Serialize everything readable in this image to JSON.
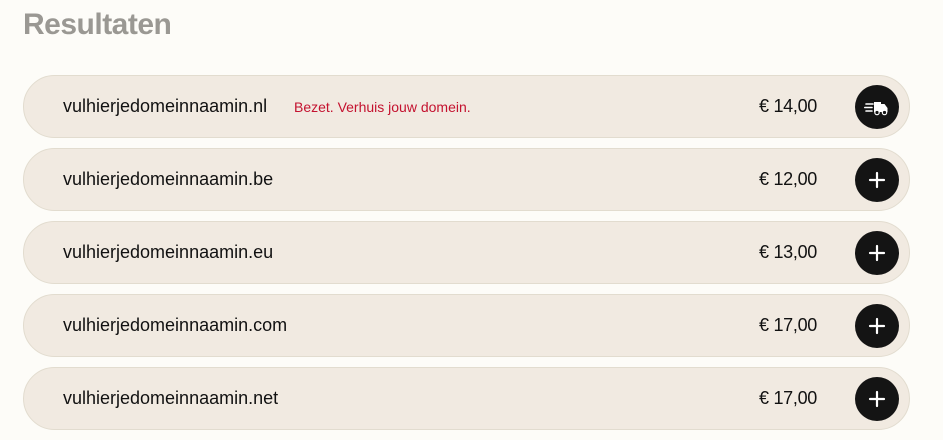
{
  "page": {
    "title": "Resultaten"
  },
  "results": [
    {
      "domain": "vulhierjedomeinnaamin.nl",
      "status": "Bezet. Verhuis jouw domein.",
      "price": "€ 14,00",
      "action_icon": "moving-truck-icon"
    },
    {
      "domain": "vulhierjedomeinnaamin.be",
      "price": "€ 12,00",
      "action_icon": "plus-icon"
    },
    {
      "domain": "vulhierjedomeinnaamin.eu",
      "price": "€ 13,00",
      "action_icon": "plus-icon"
    },
    {
      "domain": "vulhierjedomeinnaamin.com",
      "price": "€ 17,00",
      "action_icon": "plus-icon"
    },
    {
      "domain": "vulhierjedomeinnaamin.net",
      "price": "€ 17,00",
      "action_icon": "plus-icon"
    }
  ],
  "colors": {
    "page_background": "#fdfcf8",
    "row_background": "#f1eae1",
    "status_text": "#c4122f",
    "button_background": "#141414",
    "title_text": "#9a9893"
  }
}
